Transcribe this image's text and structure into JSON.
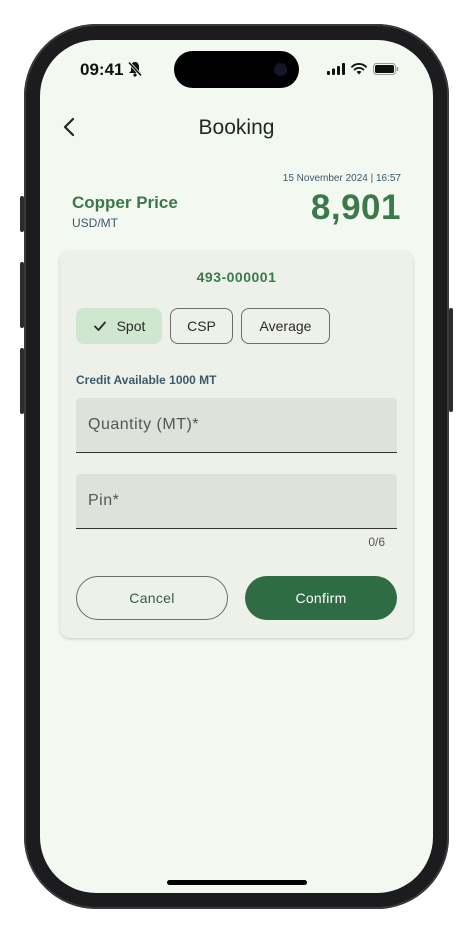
{
  "status_bar": {
    "time": "09:41"
  },
  "header": {
    "title": "Booking"
  },
  "price_panel": {
    "timestamp": "15 November 2024 | 16:57",
    "metal_name": "Copper Price",
    "unit": "USD/MT",
    "price": "8,901"
  },
  "booking_card": {
    "account_id": "493-000001",
    "price_types": [
      {
        "label": "Spot",
        "selected": true
      },
      {
        "label": "CSP",
        "selected": false
      },
      {
        "label": "Average",
        "selected": false
      }
    ],
    "credit_text": "Credit Available 1000 MT",
    "quantity_label": "Quantity (MT)*",
    "pin_label": "Pin*",
    "pin_counter": "0/6",
    "cancel_label": "Cancel",
    "confirm_label": "Confirm"
  },
  "colors": {
    "accent": "#3a7a4a",
    "confirm_bg": "#2f6b43",
    "screen_bg": "#f3f8f0"
  }
}
